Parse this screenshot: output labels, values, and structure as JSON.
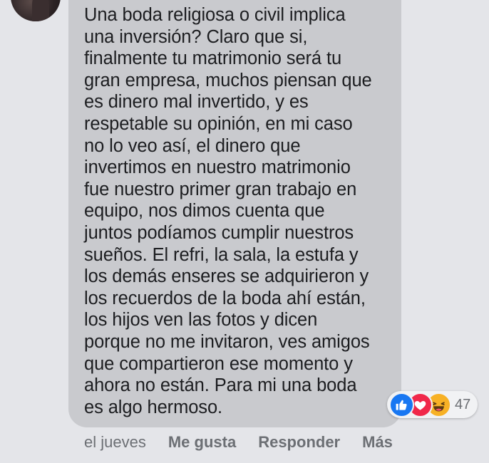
{
  "comment": {
    "lines": [
      "Una boda religiosa o civil implica",
      "una inversión? Claro que si,",
      "finalmente tu matrimonio será tu",
      "gran empresa, muchos piensan que",
      "es dinero mal invertido, y es",
      "respetable su opinión, en mi caso",
      "no lo veo así, el dinero que",
      "invertimos en nuestro matrimonio",
      "fue nuestro primer gran trabajo en",
      "equipo, nos dimos cuenta que",
      "juntos podíamos cumplir nuestros",
      "sueños. El refri, la sala, la estufa y",
      "los demás enseres se adquirieron y",
      "los recuerdos de la boda ahí están,",
      "los hijos ven las fotos y dicen",
      "porque no me invitaron, ves amigos",
      "que compartieron ese momento y",
      "ahora no están. Para mi una boda",
      "es algo hermoso."
    ]
  },
  "reactions": {
    "icons": [
      "like-icon",
      "love-icon",
      "haha-icon"
    ],
    "count": "47",
    "colors": {
      "like": "#1877f2",
      "love": "#f0284a",
      "haha": "#f7b125"
    }
  },
  "meta": {
    "time": "el jueves",
    "like_label": "Me gusta",
    "reply_label": "Responder",
    "more_label": "Más"
  }
}
